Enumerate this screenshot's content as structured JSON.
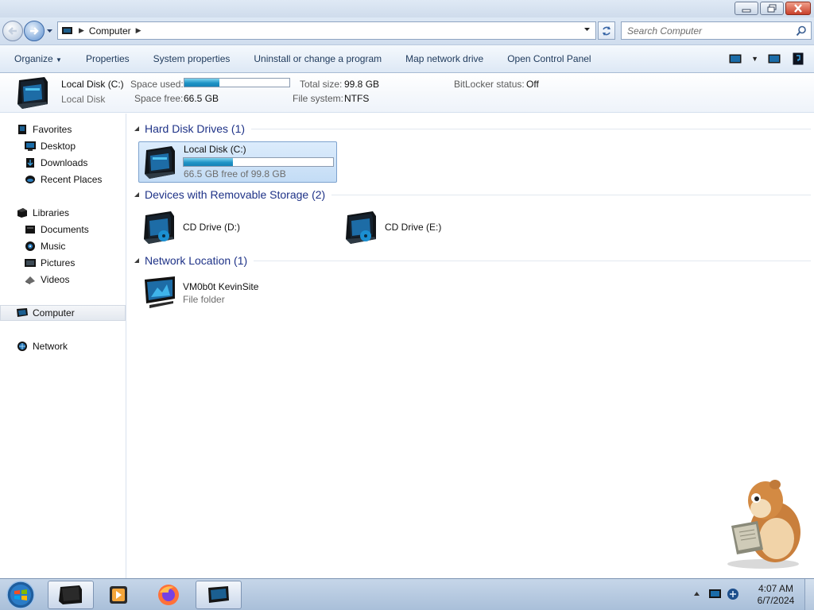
{
  "window": {
    "address_path": [
      "Computer"
    ],
    "search_placeholder": "Search Computer"
  },
  "toolbar": {
    "organize": "Organize",
    "properties": "Properties",
    "system_properties": "System properties",
    "uninstall": "Uninstall or change a program",
    "map_network_drive": "Map network drive",
    "open_control_panel": "Open Control Panel"
  },
  "details": {
    "name": "Local Disk (C:)",
    "type": "Local Disk",
    "space_used_label": "Space used:",
    "space_used_fraction": 0.33,
    "space_free_label": "Space free:",
    "space_free": "66.5 GB",
    "total_size_label": "Total size:",
    "total_size": "99.8 GB",
    "file_system_label": "File system:",
    "file_system": "NTFS",
    "bitlocker_label": "BitLocker status:",
    "bitlocker": "Off"
  },
  "nav": {
    "favorites": "Favorites",
    "desktop": "Desktop",
    "downloads": "Downloads",
    "recent_places": "Recent Places",
    "libraries": "Libraries",
    "documents": "Documents",
    "music": "Music",
    "pictures": "Pictures",
    "videos": "Videos",
    "computer": "Computer",
    "network": "Network"
  },
  "groups": {
    "hard_disk_drives": "Hard Disk Drives (1)",
    "removable": "Devices with Removable Storage (2)",
    "network_location": "Network Location (1)"
  },
  "items": {
    "local_disk": {
      "name": "Local Disk (C:)",
      "free_text": "66.5 GB free of 99.8 GB",
      "used_fraction": 0.33
    },
    "cd_d": {
      "name": "CD Drive (D:)"
    },
    "cd_e": {
      "name": "CD Drive (E:)"
    },
    "net": {
      "name": "VM0b0t KevinSite",
      "sub": "File folder"
    }
  },
  "taskbar": {
    "time": "4:07 AM",
    "date": "6/7/2024"
  },
  "colors": {
    "accent": "#1e3287",
    "bar_fill": "#1f93c6",
    "selection": "#c3dcf5"
  }
}
